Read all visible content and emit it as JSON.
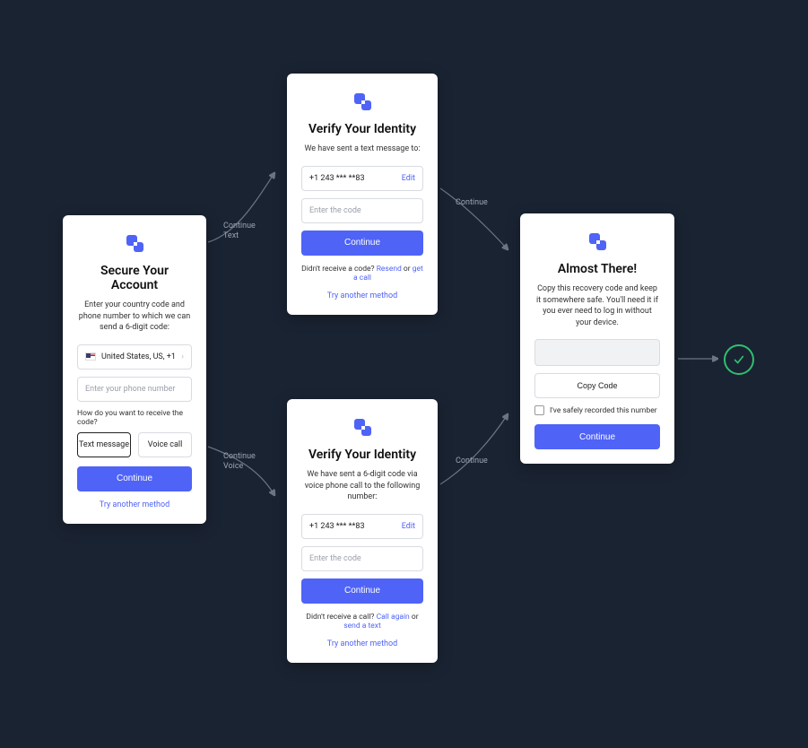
{
  "secure": {
    "title": "Secure Your Account",
    "subtitle": "Enter your country code and phone number to which we can send a 6-digit code:",
    "country": "United States, US, +1",
    "phone_placeholder": "Enter your phone number",
    "receive_label": "How do you want to receive the code?",
    "opt_text": "Text message",
    "opt_voice": "Voice call",
    "continue": "Continue",
    "try_another": "Try another method"
  },
  "verify_text": {
    "title": "Verify Your Identity",
    "subtitle": "We have sent a text message to:",
    "phone": "+1 243 *** **83",
    "edit": "Edit",
    "code_placeholder": "Enter the code",
    "continue": "Continue",
    "help_prefix": "Didn't receive a code? ",
    "resend": "Resend",
    "or": " or ",
    "alt": "get a call",
    "try_another": "Try another method"
  },
  "verify_voice": {
    "title": "Verify Your Identity",
    "subtitle": "We have sent a 6-digit code via voice phone call to the following number:",
    "phone": "+1 243 *** **83",
    "edit": "Edit",
    "code_placeholder": "Enter the code",
    "continue": "Continue",
    "help_prefix": "Didn't receive a call? ",
    "resend": "Call again",
    "or": " or ",
    "alt": "send a text",
    "try_another": "Try another method"
  },
  "almost": {
    "title": "Almost There!",
    "subtitle": "Copy this recovery code and keep it somewhere safe. You'll need it if you ever need to log in without your device.",
    "copy": "Copy Code",
    "checkbox": "I've safely recorded this number",
    "continue": "Continue"
  },
  "flow": {
    "continue_text": "Continue\nText",
    "continue_voice": "Continue\nVoice",
    "continue": "Continue"
  }
}
